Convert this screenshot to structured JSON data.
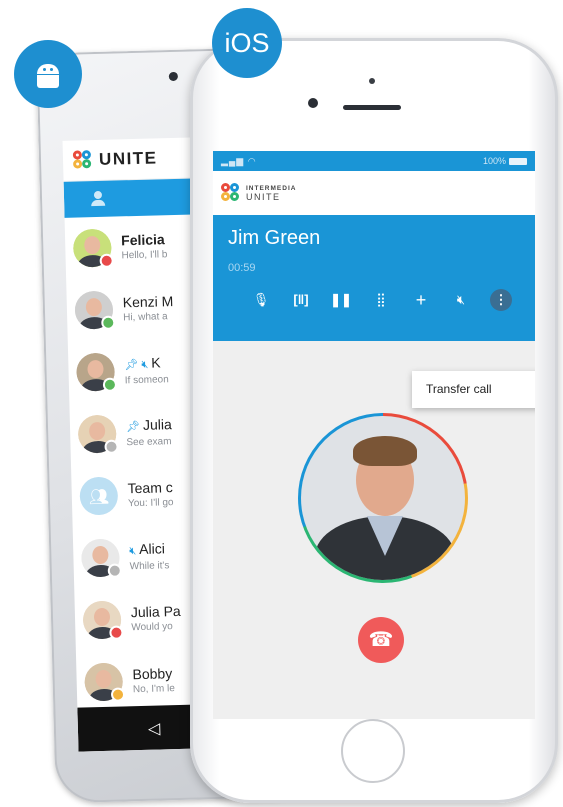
{
  "badges": {
    "android_icon": "android-robot-icon",
    "ios_label": "iOS",
    "color": "#1e8fd0"
  },
  "android": {
    "app_title": "UNITE",
    "accent": "#1e9be0",
    "contacts": [
      {
        "name": "Felicia",
        "preview": "Hello, I'll b",
        "status": "busy",
        "pinned": false,
        "muted": false
      },
      {
        "name": "Kenzi M",
        "preview": "Hi, what a",
        "status": "online",
        "pinned": false,
        "muted": false
      },
      {
        "name": "K",
        "preview": "If someon",
        "status": "online",
        "pinned": true,
        "muted": true
      },
      {
        "name": "Julia",
        "preview": "See exam",
        "status": "offline",
        "pinned": true,
        "muted": false
      },
      {
        "name": "Team c",
        "preview": "You: I'll go",
        "status": "group",
        "pinned": false,
        "muted": false
      },
      {
        "name": "Alici",
        "preview": "While it's",
        "status": "offline",
        "pinned": false,
        "muted": true
      },
      {
        "name": "Julia Pa",
        "preview": "Would yo",
        "status": "busy",
        "pinned": false,
        "muted": false
      },
      {
        "name": "Bobby",
        "preview": "No, I'm le",
        "status": "away",
        "pinned": false,
        "muted": false
      }
    ],
    "nav_back_icon": "back-triangle-icon"
  },
  "ios": {
    "status_bar": {
      "battery": "100%"
    },
    "brand": {
      "top": "INTERMEDIA",
      "bottom": "UNITE"
    },
    "call": {
      "caller_name": "Jim Green",
      "timer": "00:59",
      "controls": [
        "microphone-icon",
        "transfer-icon",
        "pause-icon",
        "keypad-icon",
        "add-icon",
        "mute-speaker-icon",
        "more-icon"
      ]
    },
    "menu": {
      "item": "Transfer call"
    },
    "hangup_icon": "hangup-phone-icon",
    "accent": "#1a95d6",
    "hangup_color": "#f05a5a"
  }
}
